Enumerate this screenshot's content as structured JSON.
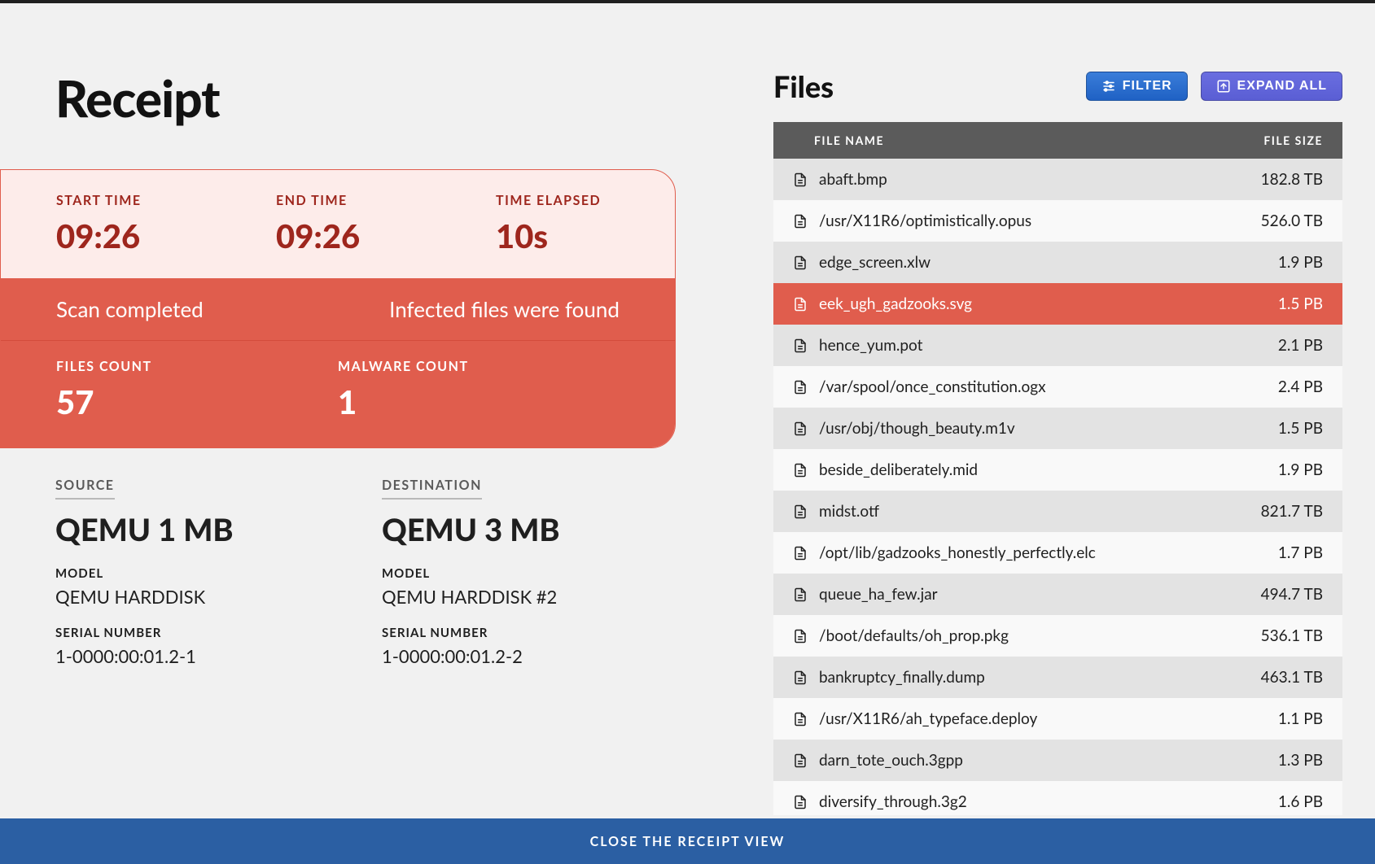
{
  "page_title": "Receipt",
  "status": {
    "start_time_label": "START TIME",
    "start_time": "09:26",
    "end_time_label": "END TIME",
    "end_time": "09:26",
    "elapsed_label": "TIME ELAPSED",
    "elapsed": "10s",
    "completed_text": "Scan completed",
    "infected_text": "Infected files were found",
    "files_count_label": "FILES COUNT",
    "files_count": "57",
    "malware_count_label": "MALWARE COUNT",
    "malware_count": "1"
  },
  "source": {
    "heading": "SOURCE",
    "name": "QEMU 1 MB",
    "model_label": "MODEL",
    "model": "QEMU HARDDISK",
    "serial_label": "SERIAL NUMBER",
    "serial": "1-0000:00:01.2-1"
  },
  "destination": {
    "heading": "DESTINATION",
    "name": "QEMU 3 MB",
    "model_label": "MODEL",
    "model": "QEMU HARDDISK #2",
    "serial_label": "SERIAL NUMBER",
    "serial": "1-0000:00:01.2-2"
  },
  "files_section": {
    "title": "Files",
    "filter_label": "FILTER",
    "expand_label": "EXPAND ALL",
    "col_name": "FILE NAME",
    "col_size": "FILE SIZE",
    "rows": [
      {
        "name": "abaft.bmp",
        "size": "182.8 TB",
        "infected": false
      },
      {
        "name": "/usr/X11R6/optimistically.opus",
        "size": "526.0 TB",
        "infected": false
      },
      {
        "name": "edge_screen.xlw",
        "size": "1.9 PB",
        "infected": false
      },
      {
        "name": "eek_ugh_gadzooks.svg",
        "size": "1.5 PB",
        "infected": true
      },
      {
        "name": "hence_yum.pot",
        "size": "2.1 PB",
        "infected": false
      },
      {
        "name": "/var/spool/once_constitution.ogx",
        "size": "2.4 PB",
        "infected": false
      },
      {
        "name": "/usr/obj/though_beauty.m1v",
        "size": "1.5 PB",
        "infected": false
      },
      {
        "name": "beside_deliberately.mid",
        "size": "1.9 PB",
        "infected": false
      },
      {
        "name": "midst.otf",
        "size": "821.7 TB",
        "infected": false
      },
      {
        "name": "/opt/lib/gadzooks_honestly_perfectly.elc",
        "size": "1.7 PB",
        "infected": false
      },
      {
        "name": "queue_ha_few.jar",
        "size": "494.7 TB",
        "infected": false
      },
      {
        "name": "/boot/defaults/oh_prop.pkg",
        "size": "536.1 TB",
        "infected": false
      },
      {
        "name": "bankruptcy_finally.dump",
        "size": "463.1 TB",
        "infected": false
      },
      {
        "name": "/usr/X11R6/ah_typeface.deploy",
        "size": "1.1 PB",
        "infected": false
      },
      {
        "name": "darn_tote_ouch.3gpp",
        "size": "1.3 PB",
        "infected": false
      },
      {
        "name": "diversify_through.3g2",
        "size": "1.6 PB",
        "infected": false
      }
    ]
  },
  "close_label": "CLOSE THE RECEIPT VIEW"
}
